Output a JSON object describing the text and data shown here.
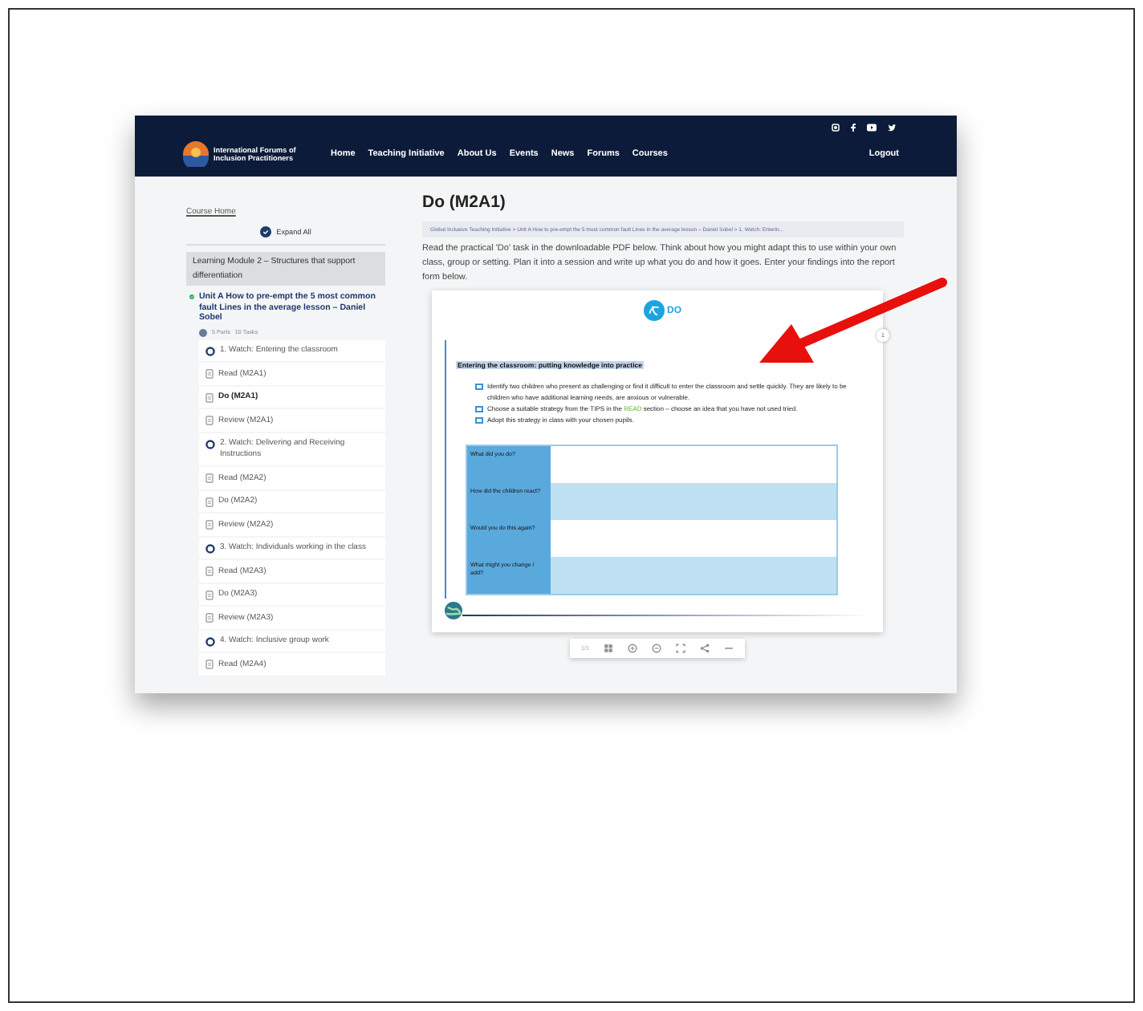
{
  "header": {
    "logo_lines": [
      "International Forums of",
      "Inclusion Practitioners"
    ],
    "nav": [
      "Home",
      "Teaching Initiative",
      "About Us",
      "Events",
      "News",
      "Forums",
      "Courses"
    ],
    "logout": "Logout"
  },
  "sidebar": {
    "course_home": "Course Home",
    "expand_all": "Expand All",
    "module": "Learning Module 2 – Structures that support differentiation",
    "unit": {
      "title": "Unit A How to pre-empt the 5 most common fault Lines in the average lesson – Daniel Sobel",
      "completed": true
    },
    "counts": [
      "5 Parts",
      "10 Tasks"
    ],
    "items": [
      {
        "kind": "watch",
        "label": "1. Watch: Entering the classroom",
        "selected": false
      },
      {
        "kind": "doc",
        "label": "Read (M2A1)",
        "selected": false
      },
      {
        "kind": "doc",
        "label": "Do (M2A1)",
        "selected": true
      },
      {
        "kind": "doc",
        "label": "Review (M2A1)",
        "selected": false
      },
      {
        "kind": "watch",
        "label": "2. Watch: Delivering and Receiving Instructions",
        "selected": false
      },
      {
        "kind": "doc",
        "label": "Read (M2A2)",
        "selected": false
      },
      {
        "kind": "doc",
        "label": "Do (M2A2)",
        "selected": false
      },
      {
        "kind": "doc",
        "label": "Review (M2A2)",
        "selected": false
      },
      {
        "kind": "watch",
        "label": "3. Watch: Individuals working in the class",
        "selected": false
      },
      {
        "kind": "doc",
        "label": "Read (M2A3)",
        "selected": false
      },
      {
        "kind": "doc",
        "label": "Do (M2A3)",
        "selected": false
      },
      {
        "kind": "doc",
        "label": "Review (M2A3)",
        "selected": false
      },
      {
        "kind": "watch",
        "label": "4. Watch: Inclusive group work",
        "selected": false
      },
      {
        "kind": "doc",
        "label": "Read (M2A4)",
        "selected": false
      }
    ]
  },
  "main": {
    "title": "Do (M2A1)",
    "breadcrumb": "Global Inclusive Teaching Initiative > Unit A How to pre-empt the 5 most common fault Lines in the average lesson – Daniel Sobel > 1. Watch: Enterin...",
    "intro": "Read the practical 'Do' task in the downloadable PDF below. Think about how you might adapt this to use within your own class, group or setting. Plan it into a session and write up what you do and how it goes. Enter your findings into the report form below.",
    "pdf": {
      "badge": "DO",
      "heading": "Entering the classroom: putting knowledge into practice",
      "bullets": [
        [
          {
            "text": "Identify two children who present as challenging or find it difficult to enter the classroom and settle quickly. They are likely to be children who have additional learning needs, are anxious or vulnerable.",
            "highlight": false
          }
        ],
        [
          {
            "text": "Choose a suitable strategy from the TIPS in the ",
            "highlight": false
          },
          {
            "text": "READ",
            "highlight": true
          },
          {
            "text": " section – choose an idea that you have not used tried.",
            "highlight": false
          }
        ],
        [
          {
            "text": "Adopt this strategy in class with your chosen pupils.",
            "highlight": false
          }
        ]
      ],
      "questions": [
        "What did you do?",
        "How did the children react?",
        "Would you do this again?",
        "What might you change / add?"
      ],
      "page": "1"
    },
    "toolbar": {
      "page": "1/1"
    }
  }
}
